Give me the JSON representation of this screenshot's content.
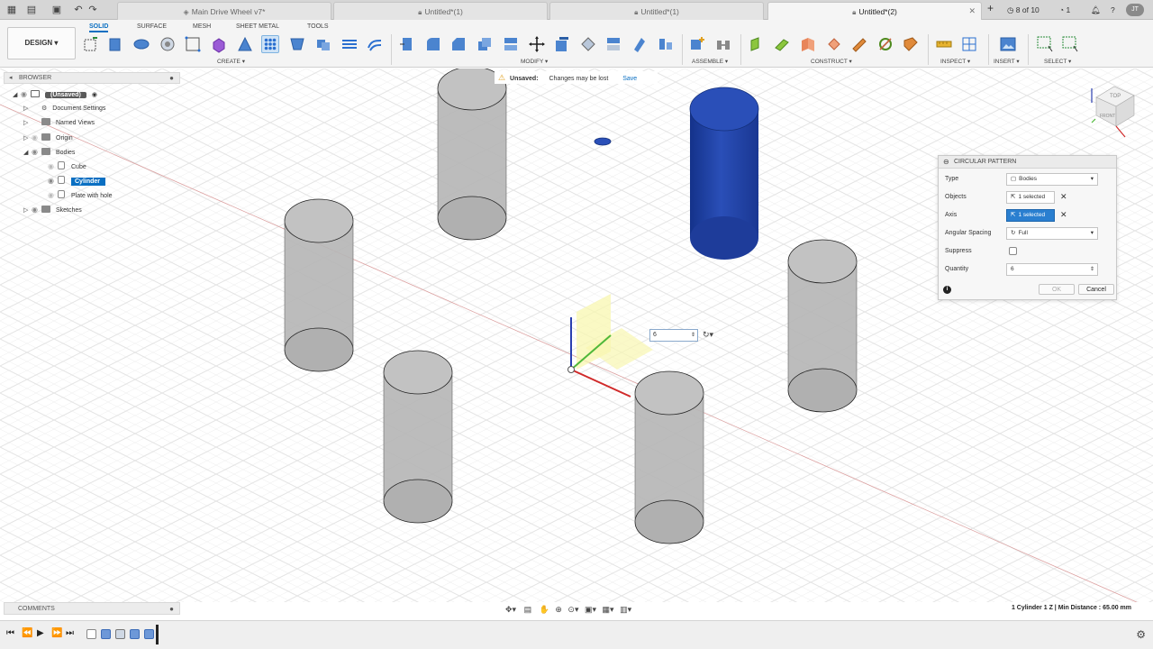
{
  "tabs": {
    "items": [
      {
        "label": "Main Drive Wheel v7*"
      },
      {
        "label": "Untitled*(1)"
      },
      {
        "label": "Untitled*(1)"
      },
      {
        "label": "Untitled*(2)"
      }
    ],
    "page_counter": "8 of 10",
    "notif_count": "1",
    "user_initials": "JT"
  },
  "toolbar": {
    "design_label": "DESIGN ▾",
    "workspaces": [
      "SOLID",
      "SURFACE",
      "MESH",
      "SHEET METAL",
      "TOOLS"
    ],
    "groups": [
      "CREATE ▾",
      "MODIFY ▾",
      "ASSEMBLE ▾",
      "CONSTRUCT ▾",
      "INSPECT ▾",
      "INSERT ▾",
      "SELECT ▾"
    ]
  },
  "browser": {
    "header": "BROWSER",
    "items": [
      {
        "label": "(Unsaved)"
      },
      {
        "label": "Document Settings"
      },
      {
        "label": "Named Views"
      },
      {
        "label": "Origin"
      },
      {
        "label": "Bodies"
      },
      {
        "label": "Cube"
      },
      {
        "label": "Cylinder"
      },
      {
        "label": "Plate with hole"
      },
      {
        "label": "Sketches"
      }
    ]
  },
  "notice": {
    "label": "Unsaved:",
    "message": "Changes may be lost",
    "save": "Save"
  },
  "dialog": {
    "title": "CIRCULAR PATTERN",
    "rows": [
      {
        "label": "Type",
        "value": "Bodies"
      },
      {
        "label": "Objects",
        "value": "1 selected"
      },
      {
        "label": "Axis",
        "value": "1 selected"
      },
      {
        "label": "Angular Spacing",
        "value": "Full"
      },
      {
        "label": "Suppress",
        "value": ""
      },
      {
        "label": "Quantity",
        "value": "6"
      }
    ],
    "ok": "OK",
    "cancel": "Cancel"
  },
  "canvas": {
    "quantity_input": "6",
    "viewcube_top": "TOP",
    "viewcube_front": "FRONT"
  },
  "comments": {
    "label": "COMMENTS"
  },
  "status": {
    "text": "1 Cylinder 1 Z | Min Distance : 65.00 mm"
  },
  "colors": {
    "accent": "#0a6fc2",
    "selected_body": "#1f3f9f",
    "ghost_body": "#b4b4b4"
  }
}
